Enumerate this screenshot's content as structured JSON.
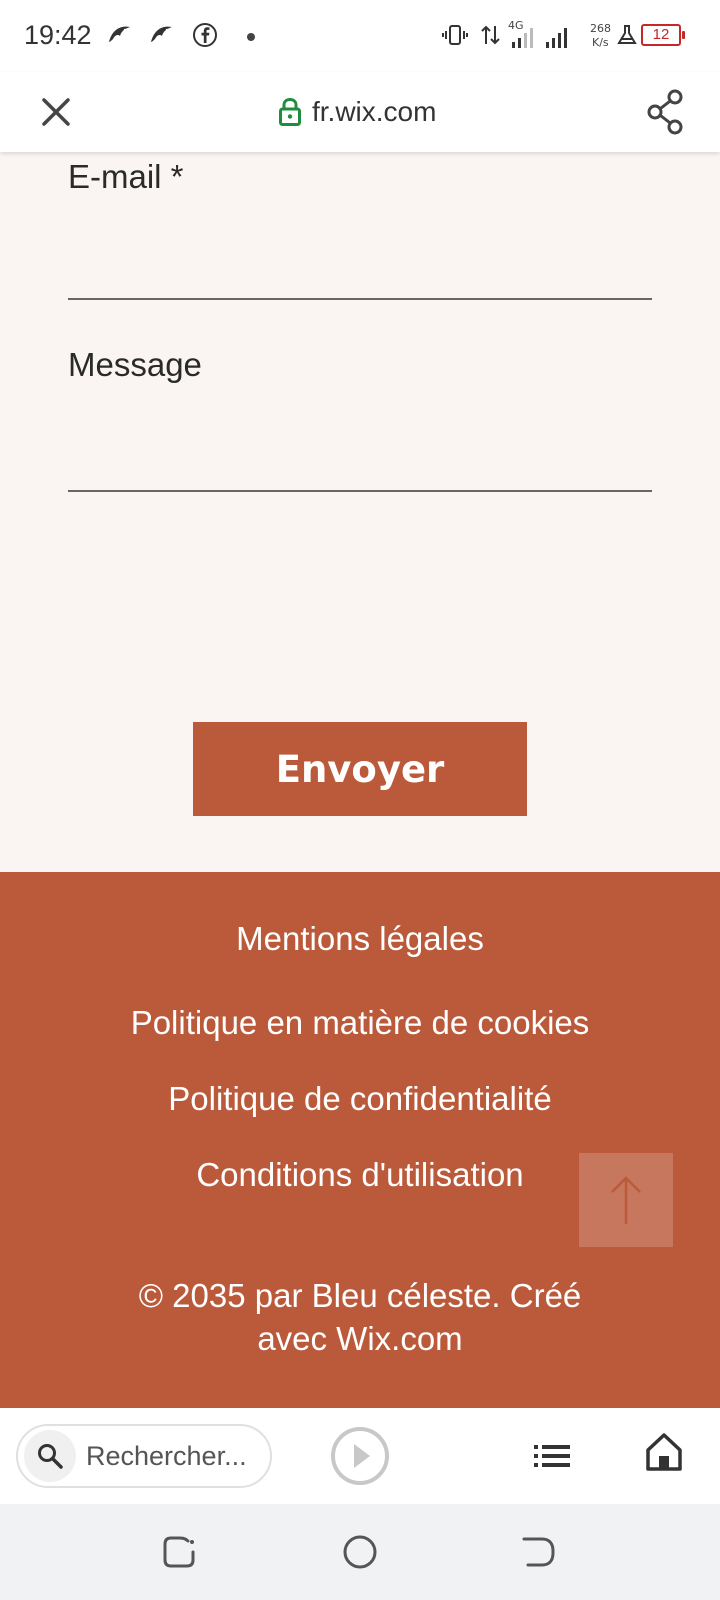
{
  "status_bar": {
    "time": "19:42",
    "net_type": "4G",
    "net_speed_value": "268",
    "net_speed_unit": "K/s",
    "battery": "12",
    "icons": [
      "app-bird-icon",
      "app-bird-icon",
      "facebook-icon",
      "dot-icon",
      "vibrate-icon",
      "data-arrows-icon",
      "signal-icon",
      "signal-icon",
      "flask-icon",
      "battery-icon"
    ]
  },
  "toolbar": {
    "url": "fr.wix.com",
    "icons": [
      "close-icon",
      "lock-icon",
      "share-icon"
    ]
  },
  "form": {
    "email_label": "E-mail *",
    "email_value": "",
    "message_label": "Message",
    "message_value": "",
    "send_label": "Envoyer"
  },
  "footer": {
    "links": [
      "Mentions légales",
      "Politique en matière de cookies",
      "Politique de confidentialité",
      "Conditions d'utilisation"
    ],
    "copyright_line1": "© 2035 par Bleu céleste. Créé",
    "copyright_line2": "avec Wix.com",
    "icons": [
      "arrow-up-icon"
    ]
  },
  "bottom_bar": {
    "search_placeholder": "Rechercher...",
    "icons": [
      "search-icon",
      "play-icon",
      "list-icon",
      "home-icon"
    ]
  },
  "nav_bar": {
    "icons": [
      "recent-apps-icon",
      "home-circle-icon",
      "back-icon"
    ]
  },
  "colors": {
    "accent": "#bb5a3a",
    "form_background": "#faf5f2",
    "lock_green": "#1e8e3e",
    "battery_red": "#c62828"
  }
}
